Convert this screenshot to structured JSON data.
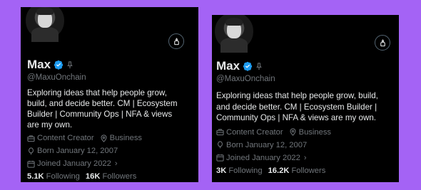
{
  "profiles": [
    {
      "display_name": "Max",
      "handle": "@MaxuOnchain",
      "bio_lines": [
        "Exploring ideas that help people grow,",
        "build, and decide better. CM | Ecosystem",
        "Builder | Community Ops | NFA & views",
        "are my own."
      ],
      "category": "Content Creator",
      "account_type": "Business",
      "born": "Born January 12, 2007",
      "joined": "Joined January 2022",
      "following_count": "5.1K",
      "following_label": "Following",
      "followers_count": "16K",
      "followers_label": "Followers"
    },
    {
      "display_name": "Max",
      "handle": "@MaxuOnchain",
      "bio_lines": [
        "Exploring ideas that help people grow, build,",
        "and decide better. CM | Ecosystem Builder |",
        "Community Ops | NFA & views are my own."
      ],
      "category": "Content Creator",
      "account_type": "Business",
      "born": "Born January 12, 2007",
      "joined": "Joined January 2022",
      "following_count": "3K",
      "following_label": "Following",
      "followers_count": "16.2K",
      "followers_label": "Followers"
    }
  ],
  "colors": {
    "background": "#a463f5",
    "card": "#000000",
    "text": "#e7e9ea",
    "muted": "#71767b",
    "verified": "#1d9bf0"
  },
  "icons": [
    "verified-badge-icon",
    "pin-icon",
    "subscribe-icon",
    "briefcase-icon",
    "location-icon",
    "balloon-icon",
    "calendar-icon",
    "chevron-right-icon"
  ]
}
